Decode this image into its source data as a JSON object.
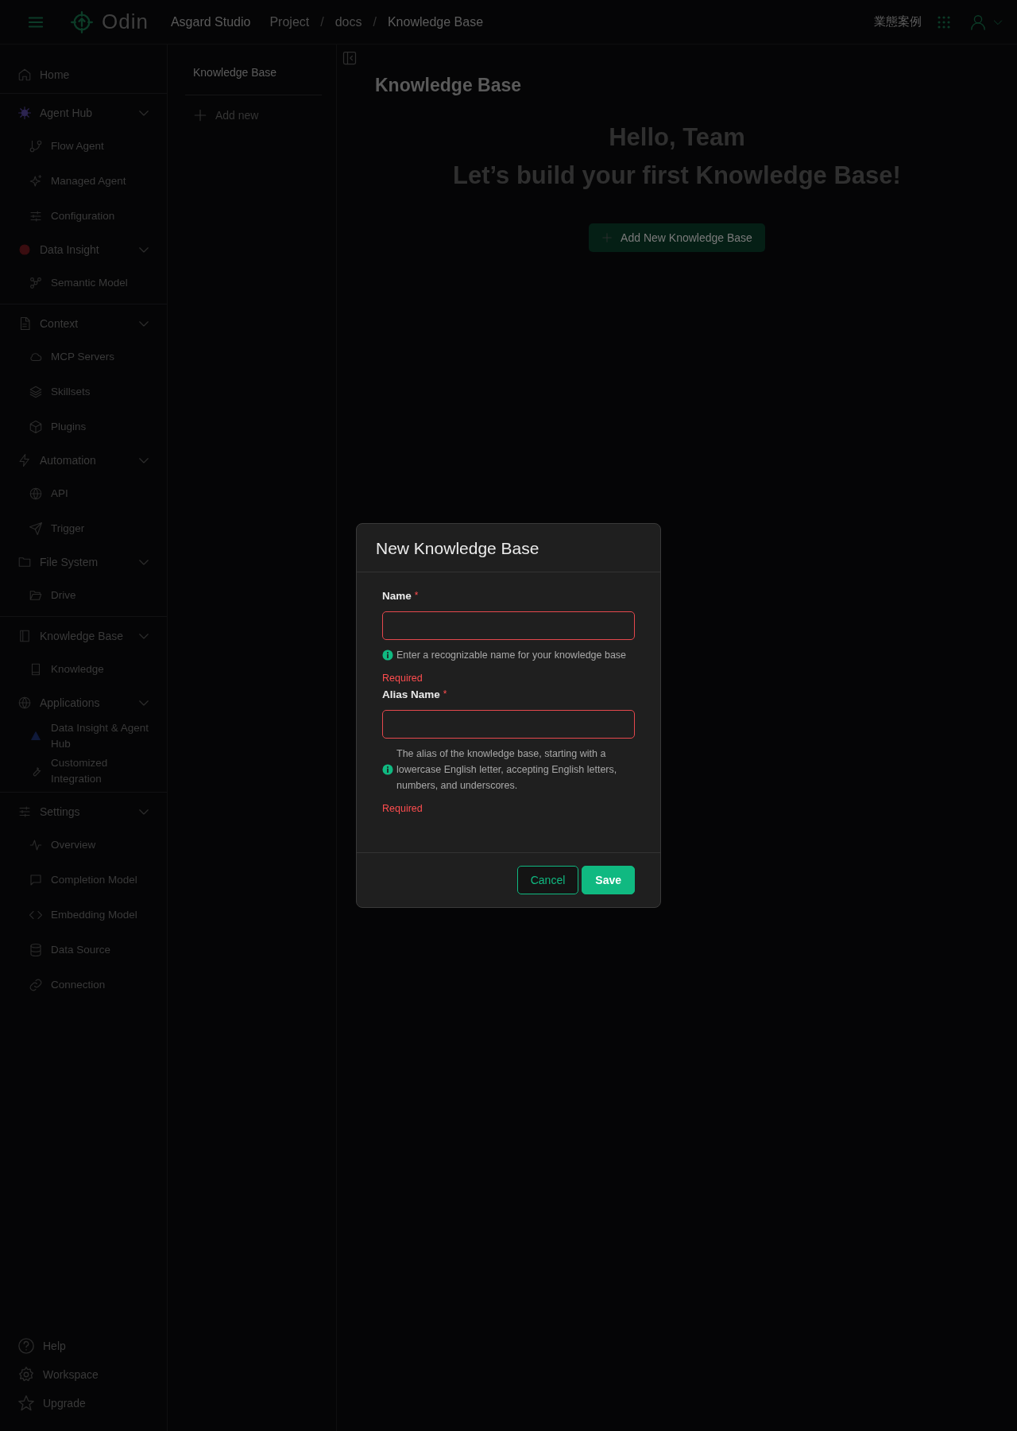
{
  "topbar": {
    "brand": "Odin",
    "workspace": "Asgard Studio",
    "breadcrumbs": [
      {
        "label": "Project",
        "separator": "/"
      },
      {
        "label": "docs",
        "separator": "/"
      },
      {
        "label": "Knowledge Base"
      }
    ],
    "right_link": "業態案例"
  },
  "sidebar": {
    "sections": [
      {
        "items": [
          {
            "label": "Home"
          }
        ]
      },
      {
        "items": [
          {
            "label": "Agent Hub",
            "expanded": true,
            "children": [
              {
                "label": "Flow Agent"
              },
              {
                "label": "Managed Agent"
              },
              {
                "label": "Configuration"
              }
            ]
          },
          {
            "label": "Data Insight",
            "expanded": true,
            "children": [
              {
                "label": "Semantic Model"
              }
            ]
          }
        ]
      },
      {
        "items": [
          {
            "label": "Context",
            "expanded": true,
            "children": [
              {
                "label": "MCP Servers"
              },
              {
                "label": "Skillsets"
              },
              {
                "label": "Plugins"
              }
            ]
          },
          {
            "label": "Automation",
            "expanded": true,
            "children": [
              {
                "label": "API"
              },
              {
                "label": "Trigger"
              }
            ]
          },
          {
            "label": "File System",
            "expanded": true,
            "children": [
              {
                "label": "Drive"
              }
            ]
          }
        ]
      },
      {
        "items": [
          {
            "label": "Knowledge Base",
            "expanded": true,
            "children": [
              {
                "label": "Knowledge"
              }
            ]
          },
          {
            "label": "Applications",
            "expanded": true,
            "children": [
              {
                "label": "Data Insight & Agent Hub"
              },
              {
                "label": "Customized Integration"
              }
            ]
          }
        ]
      },
      {
        "items": [
          {
            "label": "Settings",
            "expanded": true,
            "children": [
              {
                "label": "Overview"
              },
              {
                "label": "Completion Model"
              },
              {
                "label": "Embedding Model"
              },
              {
                "label": "Data Source"
              },
              {
                "label": "Connection"
              }
            ]
          }
        ]
      }
    ],
    "footer": [
      {
        "label": "Help"
      },
      {
        "label": "Workspace"
      },
      {
        "label": "Upgrade"
      }
    ]
  },
  "subpanel": {
    "title": "Knowledge Base",
    "add_label": "Add new"
  },
  "main": {
    "title": "Knowledge Base",
    "greeting": "Hello, Team",
    "headline": "Let’s build your first Knowledge Base!",
    "add_button": "Add New Knowledge Base"
  },
  "dialog": {
    "title": "New Knowledge Base",
    "fields": [
      {
        "label": "Name",
        "required_mark": "*",
        "invalid": true,
        "hint": "Enter a recognizable name for your knowledge base",
        "error": "Required"
      },
      {
        "label": "Alias Name",
        "required_mark": "*",
        "invalid": true,
        "hint": "The alias of the knowledge base, starting with a lowercase English letter, accepting English letters, numbers, and underscores.",
        "error": "Required"
      }
    ],
    "buttons": [
      {
        "label": "Cancel",
        "kind": "secondary"
      },
      {
        "label": "Save",
        "kind": "primary"
      }
    ]
  }
}
